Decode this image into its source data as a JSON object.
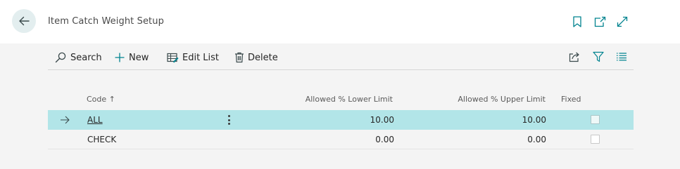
{
  "header": {
    "title": "Item Catch Weight Setup",
    "back_icon": "arrow-left-icon",
    "bookmark_icon": "bookmark-icon",
    "open_new_window_icon": "open-in-new-window-icon",
    "expand_icon": "expand-icon"
  },
  "actions": {
    "search_label": "Search",
    "new_label": "New",
    "edit_list_label": "Edit List",
    "delete_label": "Delete",
    "share_icon": "share-icon",
    "filter_icon": "filter-icon",
    "list_view_icon": "list-view-icon"
  },
  "table": {
    "columns": {
      "code": "Code",
      "sort_indicator": "↑",
      "lower": "Allowed % Lower Limit",
      "upper": "Allowed % Upper Limit",
      "fixed": "Fixed"
    },
    "rows": [
      {
        "code": "ALL",
        "lower": "10.00",
        "upper": "10.00",
        "fixed": false,
        "selected": true
      },
      {
        "code": "CHECK",
        "lower": "0.00",
        "upper": "0.00",
        "fixed": false,
        "selected": false
      }
    ]
  },
  "colors": {
    "accent": "#00838f",
    "selected_row": "#b2e5e8",
    "header_bg": "#ffffff",
    "content_bg": "#f4f4f4"
  }
}
